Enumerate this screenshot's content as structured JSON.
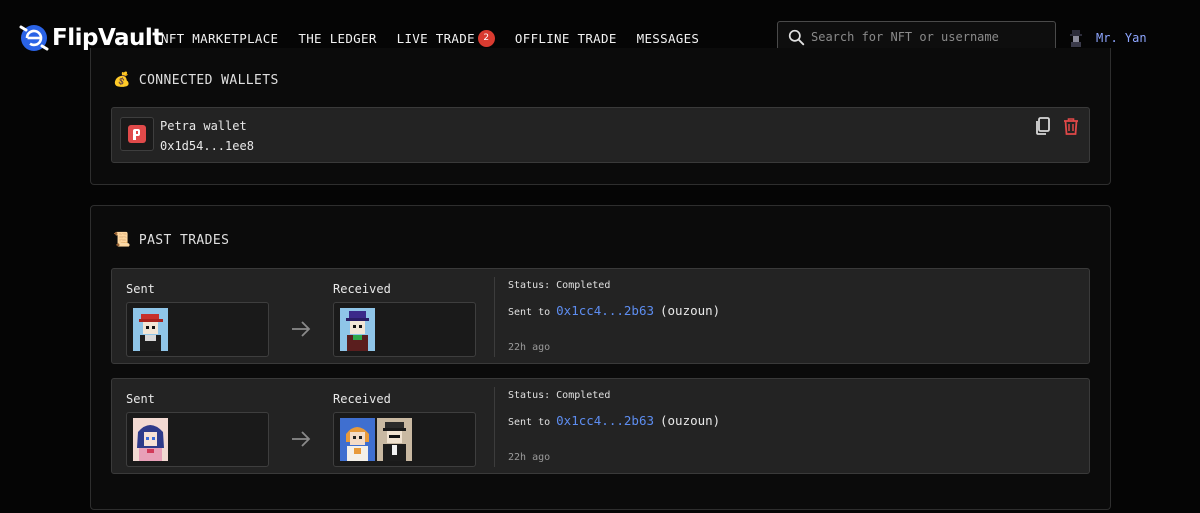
{
  "header": {
    "logo_text": "FlipVault",
    "nav": [
      {
        "label": "NFT MARKETPLACE"
      },
      {
        "label": "THE LEDGER"
      },
      {
        "label": "LIVE TRADE",
        "badge": "2"
      },
      {
        "label": "OFFLINE TRADE"
      },
      {
        "label": "MESSAGES"
      }
    ],
    "search_placeholder": "Search for NFT or username",
    "user_name": "Mr. Yan"
  },
  "wallets": {
    "title": "CONNECTED WALLETS",
    "emoji": "💰",
    "items": [
      {
        "name": "Petra wallet",
        "address": "0x1d54...1ee8",
        "icon": "petra-wallet-icon"
      }
    ]
  },
  "past_trades": {
    "title": "PAST TRADES",
    "emoji": "📜",
    "sent_label": "Sent",
    "received_label": "Received",
    "items": [
      {
        "status": "Status: Completed",
        "sent_to_label": "Sent to",
        "address": "0x1cc4...2b63",
        "user": "(ouzoun)",
        "time": "22h ago",
        "sent": [
          "red-cap-pixel-nft"
        ],
        "received": [
          "purple-hat-pixel-nft"
        ]
      },
      {
        "status": "Status: Completed",
        "sent_to_label": "Sent to",
        "address": "0x1cc4...2b63",
        "user": "(ouzoun)",
        "time": "22h ago",
        "sent": [
          "anime-girl-nft"
        ],
        "received": [
          "orange-hair-nft",
          "sailor-cap-nft"
        ]
      }
    ]
  },
  "colors": {
    "accent_link": "#5d8df0",
    "user_name": "#8ea6ff",
    "badge": "#d93b30",
    "delete": "#e04848",
    "card_bg": "#232323"
  }
}
